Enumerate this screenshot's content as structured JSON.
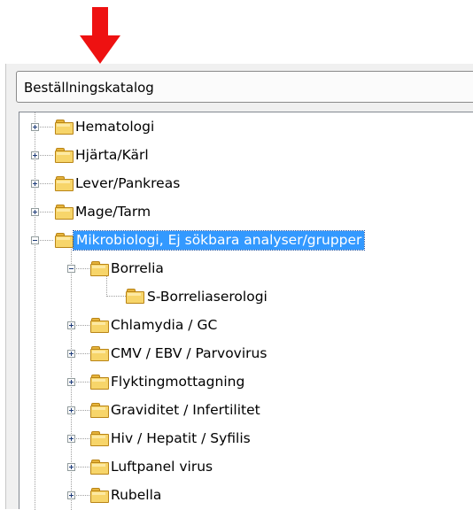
{
  "combo": {
    "value": "Beställningskatalog"
  },
  "tree": {
    "root_items": [
      "Hematologi",
      "Hjärta/Kärl",
      "Lever/Pankreas",
      "Mage/Tarm"
    ],
    "selected": "Mikrobiologi, Ej sökbara analyser/grupper",
    "borrelia": "Borrelia",
    "borrelia_child": "S-Borreliaserologi",
    "micro_children": [
      "Chlamydia / GC",
      "CMV /  EBV / Parvovirus",
      "Flyktingmottagning",
      "Graviditet / Infertilitet",
      "Hiv / Hepatit / Syfilis",
      "Luftpanel virus",
      "Rubella"
    ]
  }
}
